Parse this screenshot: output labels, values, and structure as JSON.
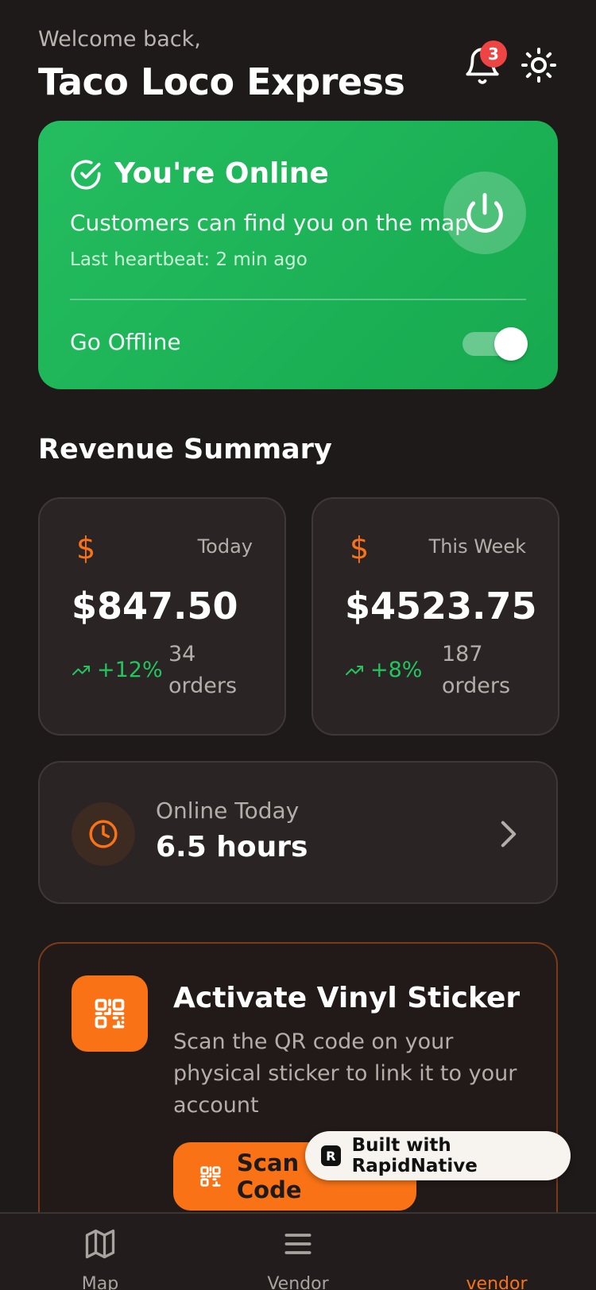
{
  "header": {
    "welcome": "Welcome back,",
    "vendor_name": "Taco Loco Express",
    "notification_count": "3",
    "bell_icon": "bell-icon",
    "theme_icon": "sun-icon"
  },
  "status": {
    "title": "You're Online",
    "description": "Customers can find you on the map",
    "heartbeat": "Last heartbeat: 2 min ago",
    "toggle_label": "Go Offline",
    "toggle_on": true,
    "color": "#1fb558"
  },
  "revenue": {
    "section_title": "Revenue Summary",
    "cards": [
      {
        "period": "Today",
        "currency_symbol": "$",
        "amount": "$847.50",
        "trend": "+12%",
        "orders_count": "34",
        "orders_word": "orders"
      },
      {
        "period": "This Week",
        "currency_symbol": "$",
        "amount": "$4523.75",
        "trend": "+8%",
        "orders_count": "187",
        "orders_word": "orders"
      }
    ]
  },
  "online": {
    "label": "Online Today",
    "value": "6.5 hours"
  },
  "sticker": {
    "title": "Activate Vinyl Sticker",
    "description": "Scan the QR code on your physical sticker to link it to your account",
    "button_label": "Scan QR Code"
  },
  "badge": {
    "logo_letter": "R",
    "text": "Built with RapidNative"
  },
  "nav": {
    "items": [
      {
        "label": "Map",
        "icon": "map-icon",
        "active": false
      },
      {
        "label": "Vendor",
        "icon": "menu-icon",
        "active": false
      },
      {
        "label": "vendor",
        "icon": "",
        "active": true
      }
    ]
  },
  "colors": {
    "accent": "#f97316",
    "positive": "#22c55e",
    "background": "#1e1a19",
    "badge": "#ef4444"
  }
}
